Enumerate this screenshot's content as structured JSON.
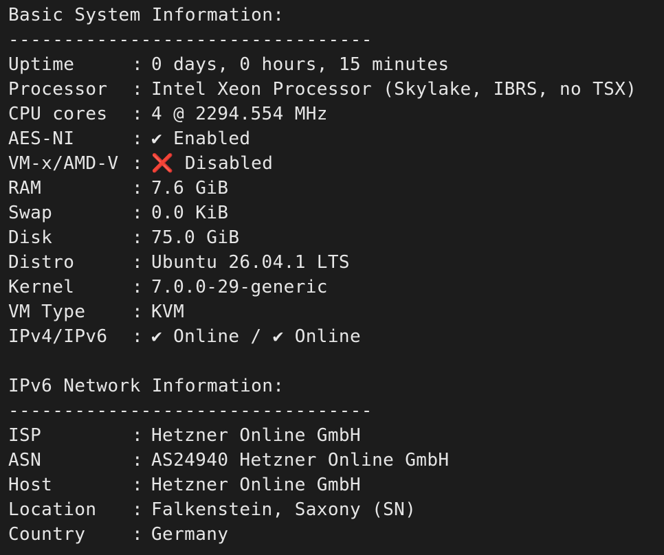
{
  "basic": {
    "heading": "Basic System Information:",
    "divider": "---------------------------------",
    "rows": [
      {
        "key": "Uptime",
        "value": "0 days, 0 hours, 15 minutes"
      },
      {
        "key": "Processor",
        "value": "Intel Xeon Processor (Skylake, IBRS, no TSX)"
      },
      {
        "key": "CPU cores",
        "value": "4 @ 2294.554 MHz"
      },
      {
        "key": "AES-NI",
        "value": "✔ Enabled"
      },
      {
        "key": "VM-x/AMD-V",
        "icon": "❌",
        "value": " Disabled"
      },
      {
        "key": "RAM",
        "value": "7.6 GiB"
      },
      {
        "key": "Swap",
        "value": "0.0 KiB"
      },
      {
        "key": "Disk",
        "value": "75.0 GiB"
      },
      {
        "key": "Distro",
        "value": "Ubuntu 26.04.1 LTS"
      },
      {
        "key": "Kernel",
        "value": "7.0.0-29-generic"
      },
      {
        "key": "VM Type",
        "value": "KVM"
      },
      {
        "key": "IPv4/IPv6",
        "value": "✔ Online / ✔ Online"
      }
    ]
  },
  "network": {
    "heading": "IPv6 Network Information:",
    "divider": "---------------------------------",
    "rows": [
      {
        "key": "ISP",
        "value": "Hetzner Online GmbH"
      },
      {
        "key": "ASN",
        "value": "AS24940 Hetzner Online GmbH"
      },
      {
        "key": "Host",
        "value": "Hetzner Online GmbH"
      },
      {
        "key": "Location",
        "value": "Falkenstein, Saxony (SN)"
      },
      {
        "key": "Country",
        "value": "Germany"
      }
    ]
  },
  "separator": ":",
  "colors": {
    "background": "#1c1c1c",
    "text": "#e6e6e6",
    "cross": "#e0402e"
  }
}
